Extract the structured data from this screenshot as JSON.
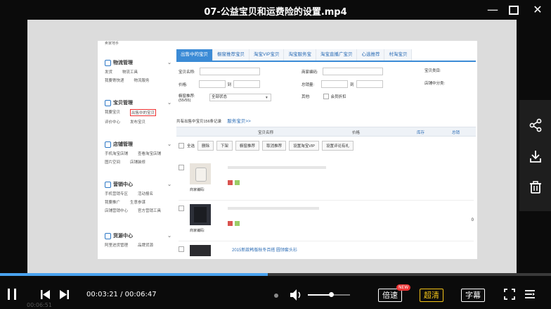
{
  "window": {
    "title": "07-公益宝贝和运费险的设置.mp4",
    "minimize_glyph": "—",
    "maximize_glyph": "☐",
    "close_glyph": "✕"
  },
  "video": {
    "breadcrumb": "卖家地手",
    "sidebar": [
      {
        "head": "物流管理",
        "rows": [
          [
            "发货",
            "物流工具"
          ],
          [
            "我要寄快递",
            "物流服务"
          ]
        ]
      },
      {
        "head": "宝贝管理",
        "rows": [
          [
            "我要宝贝",
            "出售中的宝贝"
          ],
          [
            "评价中心",
            "发布宝贝"
          ]
        ]
      },
      {
        "head": "店铺管理",
        "rows": [
          [
            "手机淘宝店铺",
            "查看淘宝店铺"
          ],
          [
            "图片空间",
            "店铺装修"
          ]
        ]
      },
      {
        "head": "营销中心",
        "rows": [
          [
            "手机营销专区",
            "活动报名"
          ],
          [
            "我要推广",
            "生意参谋"
          ],
          [
            "店铺营销中心",
            "官方营销工具"
          ]
        ]
      },
      {
        "head": "货源中心",
        "rows": [
          [
            "阿里进货管理",
            "品牌货源"
          ]
        ]
      }
    ],
    "tabs": [
      "出售中的宝贝",
      "橱窗推荐宝贝",
      "淘宝VIP宝贝",
      "淘宝服务宝",
      "淘宝直播广宝贝",
      "心选推荐",
      "村淘宝贝"
    ],
    "form": {
      "name_label": "宝贝名称:",
      "merchant_code_label": "商家编码:",
      "category_label": "宝贝类目:",
      "price_label": "价格:",
      "total_sales_label": "总销量:",
      "store_category_label": "店铺中分类:",
      "to": "到",
      "showcase_label": "橱窗推荐:",
      "showcase_count": "(55/55)",
      "status_value": "全部状态",
      "other_label": "其他:",
      "member_discount": "会员折扣"
    },
    "summary": {
      "text": "共有出售中宝贝156条记录",
      "link": "服务宝贝>>"
    },
    "table_headers": {
      "name": "宝贝名称",
      "price": "价格",
      "stock": "库存",
      "sales": "总销"
    },
    "toolbar": [
      "全选",
      "删除",
      "下架",
      "橱窗推荐",
      "取消推荐",
      "设置淘宝VIP",
      "设置评论有礼"
    ],
    "products": [
      {
        "code_label": "商家编码:",
        "price": ""
      },
      {
        "code_label": "商家编码:",
        "price": "0"
      },
      {
        "code_label": "",
        "price": "",
        "title": "2015新款韩版秋冬百搭 圆领套头衫"
      }
    ]
  },
  "player": {
    "progress_fraction": 0.486,
    "volume_fraction": 0.55,
    "time": "00:03:21 / 00:06:47",
    "ghost_time": "00:06:51",
    "speed_label": "倍速",
    "speed_badge": "NEW",
    "quality_label": "超清",
    "subtitle_label": "字幕"
  },
  "side_panel": {
    "share_icon": "share-icon",
    "download_icon": "download-icon",
    "delete_icon": "trash-icon"
  },
  "colors": {
    "accent": "#4aa3f0",
    "quality_text": "#f5c518",
    "badge": "#e33333"
  }
}
